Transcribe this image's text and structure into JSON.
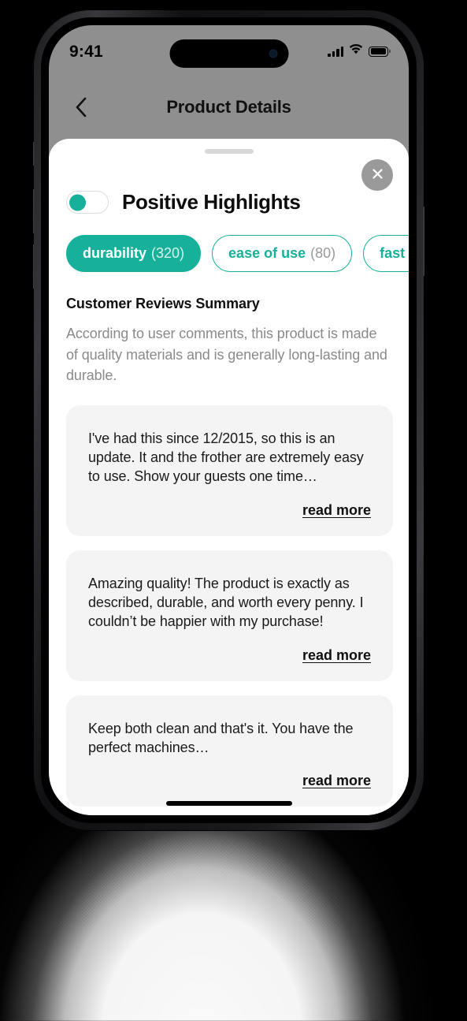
{
  "theme": {
    "accent": "#17b09a",
    "sheet_bg": "#ffffff",
    "card_bg": "#f4f4f4",
    "screen_dim_bg": "#8f8f8f",
    "muted_text": "#8a8a8a"
  },
  "status_bar": {
    "time": "9:41",
    "signal_icon": "cellular-bars-icon",
    "wifi_icon": "wifi-icon",
    "battery_icon": "battery-full-icon"
  },
  "app_header": {
    "back_icon": "chevron-left-icon",
    "title": "Product Details"
  },
  "sheet": {
    "drag_handle": "drag-handle",
    "close_icon": "close-icon",
    "toggle": {
      "label": "Positive Highlights",
      "state": "on"
    },
    "chips": [
      {
        "label": "durability",
        "count": "(320)",
        "selected": true
      },
      {
        "label": "ease of use",
        "count": "(80)",
        "selected": false
      },
      {
        "label": "fast brew",
        "count": "",
        "selected": false
      }
    ],
    "summary": {
      "title": "Customer Reviews Summary",
      "text": "According to user comments, this product is made of quality materials and is generally long-lasting and durable."
    },
    "reviews": [
      {
        "text": "I've had this since 12/2015, so this is an update. It and the frother are extremely easy to use. Show your guests one time…",
        "read_more": "read more"
      },
      {
        "text": "Amazing quality! The product is exactly as described, durable, and worth every penny. I couldn’t be happier with my purchase!",
        "read_more": "read more"
      },
      {
        "text": "Keep both clean and that's it. You have the perfect machines…",
        "read_more": "read more"
      }
    ]
  }
}
